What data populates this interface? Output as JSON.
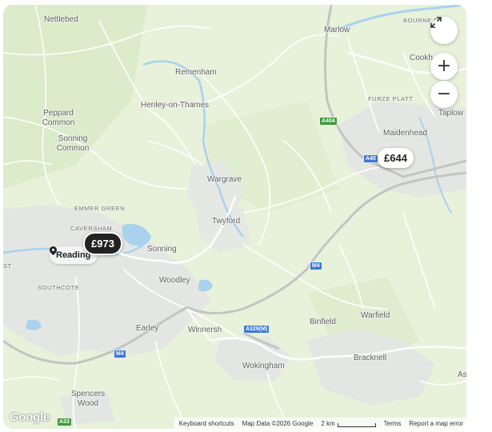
{
  "map": {
    "places": [
      {
        "id": "nettlebed",
        "label": "Nettlebed",
        "style": "normal"
      },
      {
        "id": "marlow",
        "label": "Marlow",
        "style": "normal"
      },
      {
        "id": "bourne-end",
        "label": "BOURNE E",
        "style": "small"
      },
      {
        "id": "cookham",
        "label": "Cookh",
        "style": "normal"
      },
      {
        "id": "remenham",
        "label": "Remenham",
        "style": "normal"
      },
      {
        "id": "henley",
        "label": "Henley-on-Thames",
        "style": "normal"
      },
      {
        "id": "peppard",
        "label": "Peppard\nCommon",
        "style": "normal"
      },
      {
        "id": "furze-platt",
        "label": "FURZE PLATT",
        "style": "small"
      },
      {
        "id": "taplow",
        "label": "Taplow",
        "style": "normal"
      },
      {
        "id": "maidenhead",
        "label": "Maidenhead",
        "style": "normal"
      },
      {
        "id": "sonning-common",
        "label": "Sonning\nCommon",
        "style": "normal"
      },
      {
        "id": "wargrave",
        "label": "Wargrave",
        "style": "normal"
      },
      {
        "id": "emmer-green",
        "label": "EMMER GREEN",
        "style": "small"
      },
      {
        "id": "caversham",
        "label": "CAVERSHAM",
        "style": "small"
      },
      {
        "id": "twyford",
        "label": "Twyford",
        "style": "normal"
      },
      {
        "id": "sonning",
        "label": "Sonning",
        "style": "normal"
      },
      {
        "id": "st",
        "label": "ST",
        "style": "small"
      },
      {
        "id": "woodley",
        "label": "Woodley",
        "style": "normal"
      },
      {
        "id": "southcote",
        "label": "SOUTHCOTE",
        "style": "small"
      },
      {
        "id": "binfield",
        "label": "Binfield",
        "style": "normal"
      },
      {
        "id": "warfield",
        "label": "Warfield",
        "style": "normal"
      },
      {
        "id": "earley",
        "label": "Earley",
        "style": "normal"
      },
      {
        "id": "winnersh",
        "label": "Winnersh",
        "style": "normal"
      },
      {
        "id": "bracknell",
        "label": "Bracknell",
        "style": "normal"
      },
      {
        "id": "wokingham",
        "label": "Wokingham",
        "style": "normal"
      },
      {
        "id": "as",
        "label": "As",
        "style": "normal"
      },
      {
        "id": "spencers-wood",
        "label": "Spencers\nWood",
        "style": "normal"
      }
    ],
    "road_shields": [
      {
        "id": "a404-north",
        "label": "A404",
        "type": "a"
      },
      {
        "id": "a404-east",
        "label": "A40",
        "type": "m"
      },
      {
        "id": "m4-mid",
        "label": "M4",
        "type": "m"
      },
      {
        "id": "a329m",
        "label": "A329(M)",
        "type": "m"
      },
      {
        "id": "m4-west",
        "label": "M4",
        "type": "m"
      },
      {
        "id": "a33",
        "label": "A33",
        "type": "a"
      }
    ],
    "markers": {
      "price_reading": "£973",
      "price_maidenhead": "£644",
      "location_label": "Reading"
    },
    "controls": {
      "fullscreen_icon": "expand-icon",
      "zoom_in_label": "+",
      "zoom_out_label": "−"
    },
    "logo_text": "Google",
    "footer": {
      "shortcuts": "Keyboard shortcuts",
      "map_data": "Map Data ©2026 Google",
      "scale": "2 km",
      "terms": "Terms",
      "report": "Report a map error"
    },
    "colors": {
      "land": "#e9f2dc",
      "urban": "#e3e5e3",
      "water": "#a8d2ee",
      "motorway": "#c4c4c4"
    }
  }
}
